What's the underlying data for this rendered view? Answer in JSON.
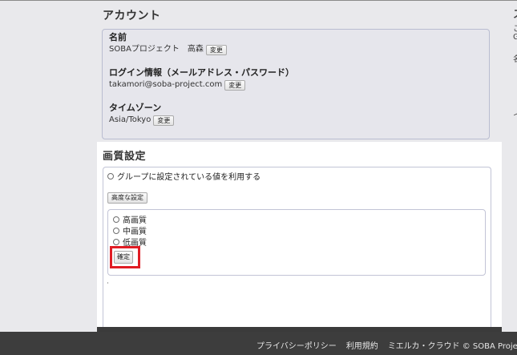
{
  "account": {
    "title": "アカウント",
    "name_label": "名前",
    "name_value": "SOBAプロジェクト　高森",
    "login_label": "ログイン情報（メールアドレス・パスワード）",
    "login_value": "takamori@soba-project.com",
    "timezone_label": "タイムゾーン",
    "timezone_value": "Asia/Tokyo",
    "change_label": "変更"
  },
  "quality": {
    "title": "画質設定",
    "use_group_label": "グループに設定されている値を利用する",
    "advanced_button": "高度な設定",
    "options": [
      "高画質",
      "中画質",
      "低画質"
    ],
    "confirm_button": "確定"
  },
  "footer": {
    "privacy": "プライバシーポリシー",
    "terms": "利用規約",
    "copyright": "ミエルカ・クラウド © SOBA Projec"
  },
  "right_column_glyphs": [
    "ス",
    "こ",
    "G",
    "名",
    "イ"
  ]
}
